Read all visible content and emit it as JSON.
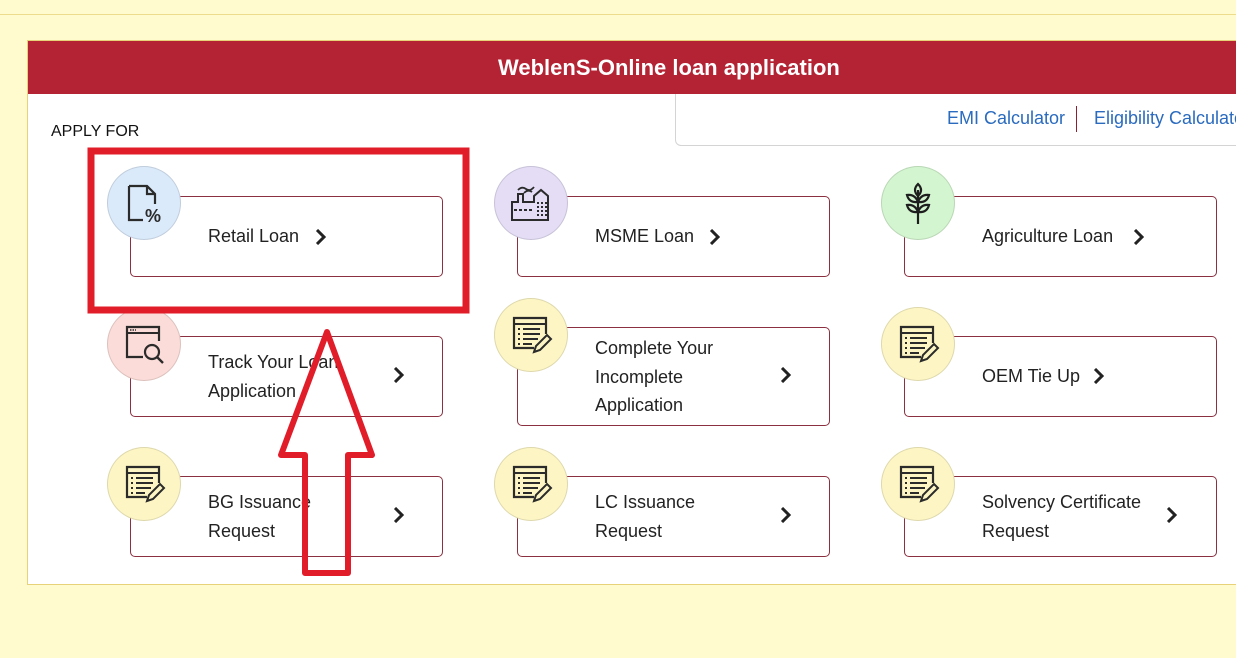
{
  "header": {
    "title": "WeblenS-Online loan application"
  },
  "calculators": {
    "emi_label": "EMI Calculator",
    "eligibility_label": "Eligibility Calculator"
  },
  "section": {
    "apply_for_label": "APPLY FOR"
  },
  "cards": [
    {
      "label": "Retail Loan",
      "icon": "document-percent-icon",
      "icon_bg": "#dbeafb"
    },
    {
      "label": "MSME Loan",
      "icon": "factory-icon",
      "icon_bg": "#e4ddf5"
    },
    {
      "label": "Agriculture Loan",
      "icon": "wheat-icon",
      "icon_bg": "#d3f5cf"
    },
    {
      "label": "Track Your Loan Application",
      "label_line1": "Track Your Loan",
      "label_line2": "Application",
      "icon": "browser-search-icon",
      "icon_bg": "#fbdcd8"
    },
    {
      "label": "Complete Your Incomplete Application",
      "label_line1": "Complete Your",
      "label_line2": "Incomplete",
      "label_line3": "Application",
      "icon": "form-edit-icon",
      "icon_bg": "#fdf6c4"
    },
    {
      "label": "OEM Tie Up",
      "icon": "form-edit-icon",
      "icon_bg": "#fdf6c4"
    },
    {
      "label": "BG Issuance Request",
      "label_line1": "BG Issuance",
      "label_line2": "Request",
      "icon": "form-edit-icon",
      "icon_bg": "#fdf6c4"
    },
    {
      "label": "LC Issuance Request",
      "label_line1": "LC Issuance",
      "label_line2": "Request",
      "icon": "form-edit-icon",
      "icon_bg": "#fdf6c4"
    },
    {
      "label": "Solvency Certificate Request",
      "label_line1": "Solvency Certificate",
      "label_line2": "Request",
      "icon": "form-edit-icon",
      "icon_bg": "#fdf6c4"
    }
  ],
  "colors": {
    "header_bg": "#b32333",
    "page_bg": "#fffbcf",
    "link": "#2a6bbf",
    "card_border": "#8b3040",
    "annotation": "#e11d2a"
  },
  "annotations": {
    "highlight_box_target": "Retail Loan",
    "arrow_direction": "up"
  }
}
